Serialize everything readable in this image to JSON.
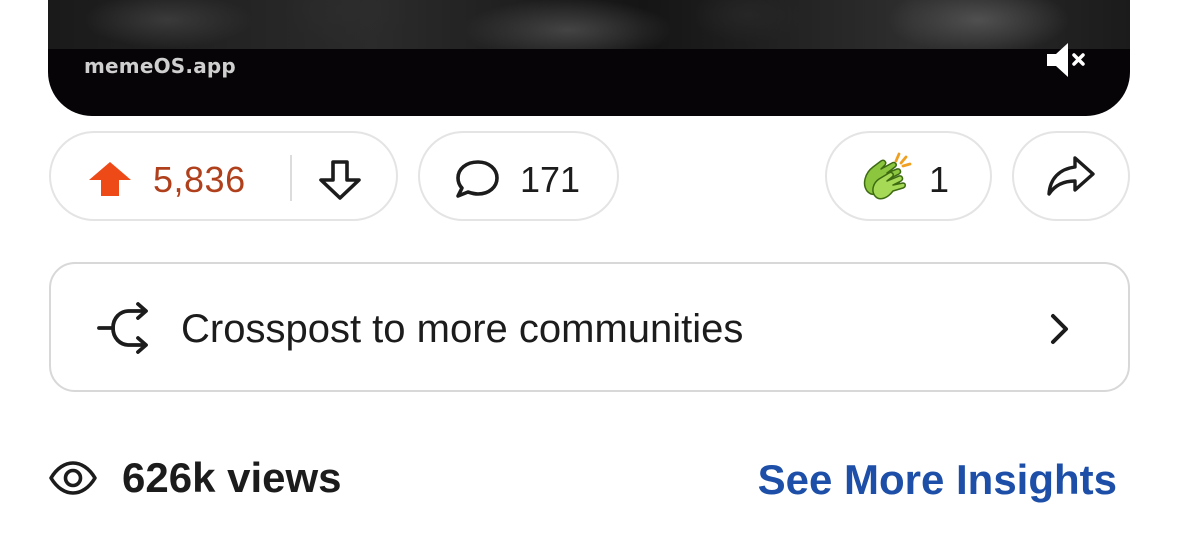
{
  "video": {
    "watermark": "memeOS.app",
    "mute_icon": "speaker-muted-icon"
  },
  "actions": {
    "score": "5,836",
    "upvote_icon": "arrow-up-icon",
    "downvote_icon": "arrow-down-icon",
    "upvote_color": "#ee4a18",
    "score_color": "#b0401c",
    "comments_count": "171",
    "comment_icon": "speech-bubble-icon",
    "award_count": "1",
    "award_icon": "clapping-hands-award-icon",
    "share_icon": "share-arrow-icon"
  },
  "crosspost": {
    "label": "Crosspost to more communities",
    "icon": "crosspost-arrows-icon",
    "chevron": "chevron-right-icon"
  },
  "insights": {
    "views": "626k views",
    "eye_icon": "eye-icon",
    "link_label": "See More Insights",
    "link_color": "#1d4fa8"
  }
}
